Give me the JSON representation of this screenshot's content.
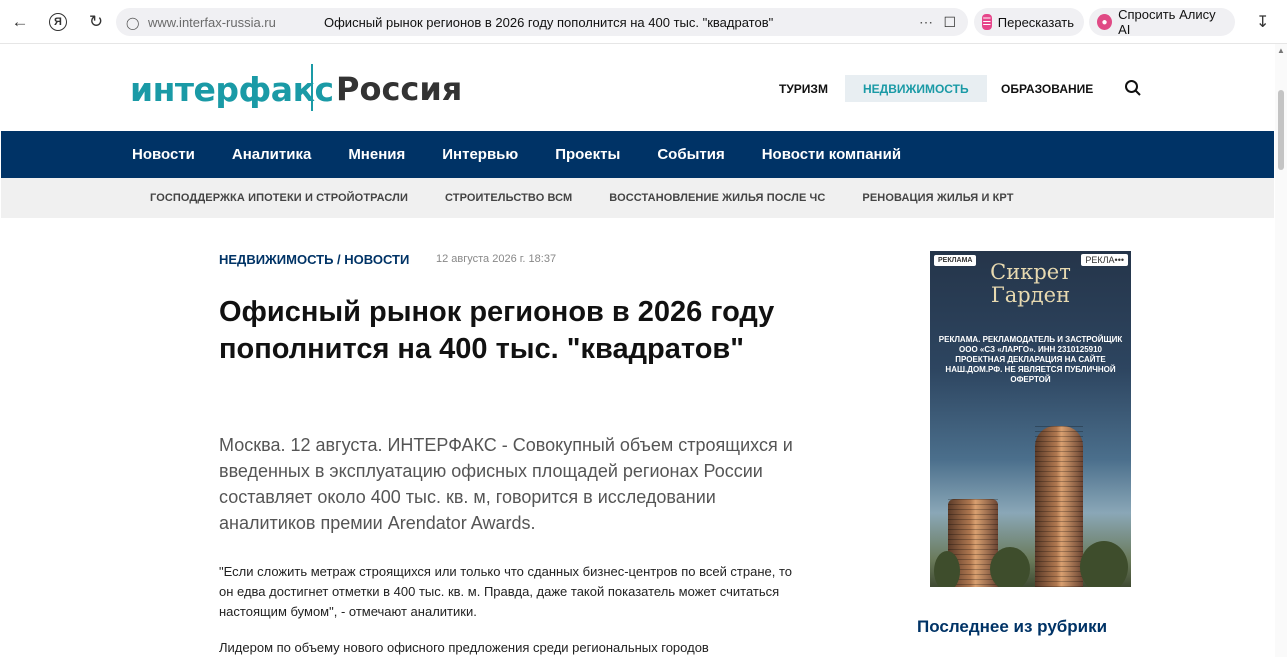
{
  "browser": {
    "url": "www.interfax-russia.ru",
    "tab_title": "Офисный рынок регионов в 2026 году пополнится на 400 тыс. \"квадратов\"",
    "ya_label": "Я",
    "retell_label": "Пересказать",
    "alice_label": "Спросить Алису AI"
  },
  "site": {
    "logo": "интерфакс",
    "region": "Россия",
    "top_links": [
      "ТУРИЗМ",
      "НЕДВИЖИМОСТЬ",
      "ОБРАЗОВАНИЕ"
    ],
    "main_nav": [
      "Новости",
      "Аналитика",
      "Мнения",
      "Интервью",
      "Проекты",
      "События",
      "Новости компаний"
    ],
    "sub_nav": [
      "ГОСПОДДЕРЖКА ИПОТЕКИ И СТРОЙОТРАСЛИ",
      "СТРОИТЕЛЬСТВО ВСМ",
      "ВОССТАНОВЛЕНИЕ ЖИЛЬЯ ПОСЛЕ ЧС",
      "РЕНОВАЦИЯ ЖИЛЬЯ И КРТ"
    ]
  },
  "article": {
    "breadcrumb": "НЕДВИЖИМОСТЬ / НОВОСТИ",
    "date": "12 августа 2026 г. 18:37",
    "headline": "Офисный рынок регионов в 2026 году пополнится на 400 тыс. \"квадратов\"",
    "lead": "Москва. 12 августа. ИНТЕРФАКС - Совокупный объем строящихся и введенных в эксплуатацию офисных площадей регионах России составляет около 400 тыс. кв. м, говорится в исследовании аналитиков премии Arendator Awards.",
    "para1": "\"Если сложить метраж строящихся или только что сданных бизнес-центров по всей стране, то он едва достигнет отметки в 400 тыс. кв. м. Правда, даже такой показатель может считаться настоящим бумом\", - отмечают аналитики.",
    "para2": "Лидером по объему нового офисного предложения среди региональных городов"
  },
  "ad": {
    "label": "РЕКЛАМА",
    "label2": "РЕКЛА",
    "brand_line1": "Сикрет",
    "brand_line2": "Гарден",
    "fine_print": "РЕКЛАМА. РЕКЛАМОДАТЕЛЬ И ЗАСТРОЙЩИК ООО «СЗ «ЛАРГО». ИНН 2310125910 ПРОЕКТНАЯ ДЕКЛАРАЦИЯ НА САЙТЕ НАШ.ДОМ.РФ. НЕ ЯВЛЯЕТСЯ ПУБЛИЧНОЙ ОФЕРТОЙ"
  },
  "sidebar": {
    "heading": "Последнее из рубрики"
  },
  "colors": {
    "brand_teal": "#1a9aa6",
    "nav_blue": "#003366"
  }
}
